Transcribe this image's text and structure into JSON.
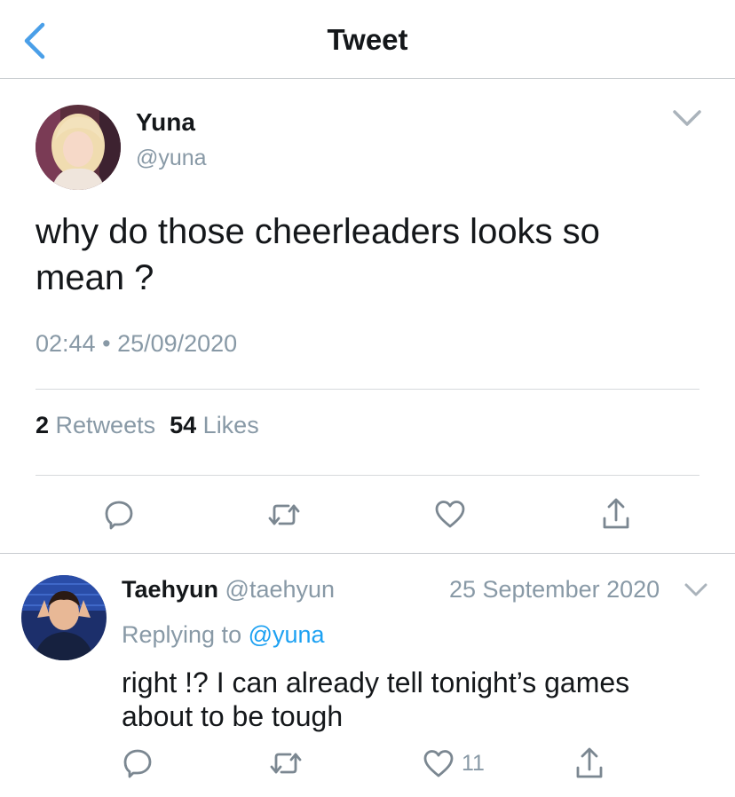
{
  "header": {
    "title": "Tweet",
    "back_icon": "chevron-left-icon"
  },
  "tweet": {
    "author_name": "Yuna",
    "author_handle": "@yuna",
    "text": "why do those cheerleaders looks so mean ?",
    "time": "02:44",
    "separator": "•",
    "date": "25/09/2020",
    "retweets": {
      "count": "2",
      "label": "Retweets"
    },
    "likes": {
      "count": "54",
      "label": "Likes"
    },
    "actions": [
      "reply-icon",
      "retweet-icon",
      "like-icon",
      "share-icon"
    ]
  },
  "reply": {
    "author_name": "Taehyun",
    "author_handle": "@taehyun",
    "date": "25 September 2020",
    "replying_label": "Replying to",
    "replying_to": "@yuna",
    "text": "right !? I can already tell tonight’s games about to be tough",
    "like_count": "11",
    "actions": [
      "reply-icon",
      "retweet-icon",
      "like-icon",
      "share-icon"
    ]
  },
  "colors": {
    "accent": "#1da1f2",
    "text": "#14171a",
    "secondary": "#8899a6",
    "divider": "#d6d9dc",
    "icon": "#7b8791"
  }
}
